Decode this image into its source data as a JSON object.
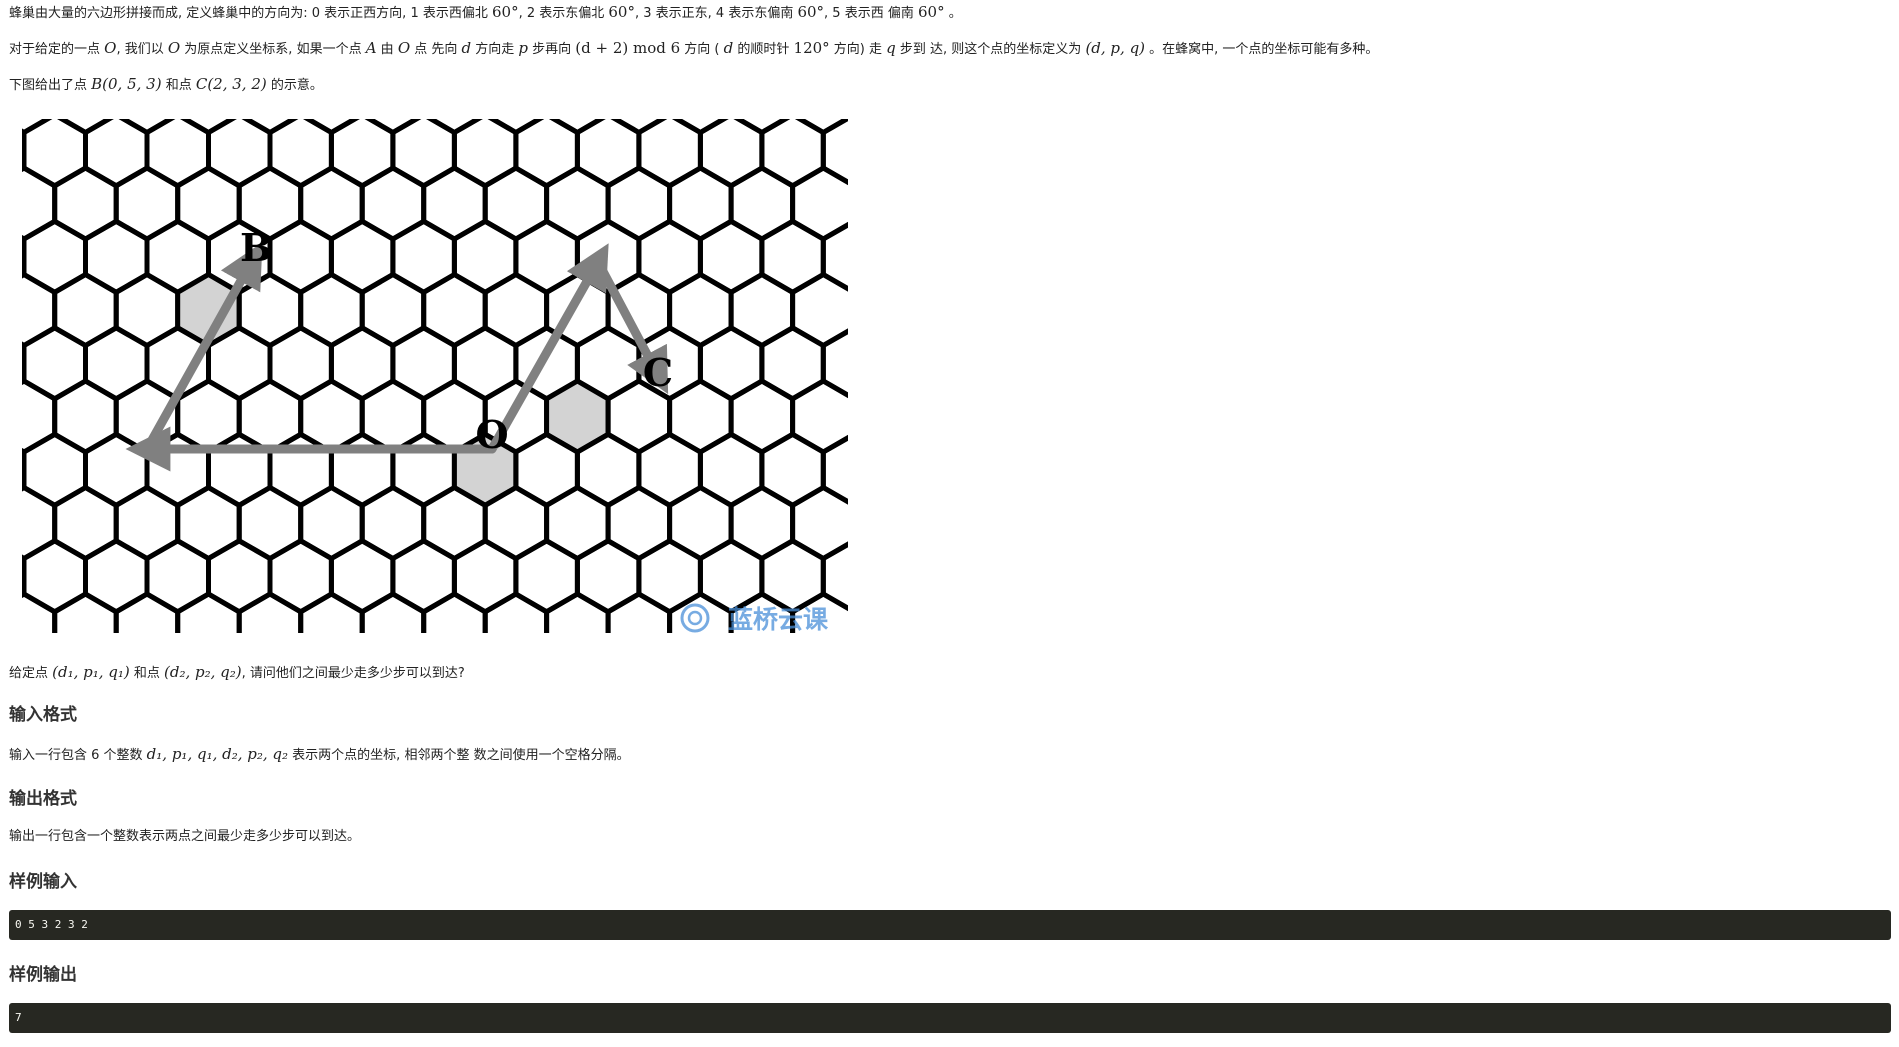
{
  "text": {
    "p1_a": "蜂巢由大量的六边形拼接而成, 定义蜂巢中的方向为: 0 表示正西方向, 1 表示西偏北 ",
    "p1_m1": "60°",
    "p1_b": ", 2 表示东偏北 ",
    "p1_m2": "60°",
    "p1_c": ", 3 表示正东, 4 表示东偏南 ",
    "p1_m3": "60°",
    "p1_d": ", 5 表示西 偏南 ",
    "p1_m4": "60°",
    "p1_e": " 。",
    "p2_a": "对于给定的一点 ",
    "p2_m1": "O",
    "p2_b": ", 我们以 ",
    "p2_m2": "O",
    "p2_c": " 为原点定义坐标系, 如果一个点 ",
    "p2_m3": "A",
    "p2_d": " 由 ",
    "p2_m4": "O",
    "p2_e": " 点 先向 ",
    "p2_m5": "d",
    "p2_f": " 方向走 ",
    "p2_m6": "p",
    "p2_g": " 步再向 ",
    "p2_m7": "(d + 2) mod 6",
    "p2_h": " 方向 ( ",
    "p2_m8": "d",
    "p2_i": " 的顺时针 ",
    "p2_m9": "120°",
    "p2_j": " 方向) 走 ",
    "p2_m10": "q",
    "p2_k": " 步到 达, 则这个点的坐标定义为 ",
    "p2_m11": "(d, p, q)",
    "p2_l": " 。在蜂窝中, 一个点的坐标可能有多种。",
    "p3_a": "下图给出了点 ",
    "p3_m1": "B(0, 5, 3)",
    "p3_b": " 和点 ",
    "p3_m2": "C(2, 3, 2)",
    "p3_c": " 的示意。",
    "p4_a": "给定点 ",
    "p4_m1": "(d₁, p₁, q₁)",
    "p4_b": " 和点 ",
    "p4_m2": "(d₂, p₂, q₂)",
    "p4_c": ", 请问他们之间最少走多少步可以到达?",
    "sec_input": "输入格式",
    "p5_a": "输入一行包含 6 个整数 ",
    "p5_m1": "d₁, p₁, q₁, d₂, p₂, q₂",
    "p5_b": " 表示两个点的坐标, 相邻两个整 数之间使用一个空格分隔。",
    "sec_output": "输出格式",
    "p6": "输出一行包含一个整数表示两点之间最少走多少步可以到达。",
    "sec_sample_in": "样例输入",
    "sample_in": "0 5 3 2 3 2",
    "sec_sample_out": "样例输出",
    "sample_out": "7"
  },
  "figure": {
    "label_B": "B",
    "label_C": "C",
    "label_O": "O",
    "watermark": "蓝桥云课",
    "colors": {
      "grid": "#000000",
      "highlight": "#d3d3d3",
      "arrow": "#808080",
      "watermark": "#4a90d9"
    }
  }
}
